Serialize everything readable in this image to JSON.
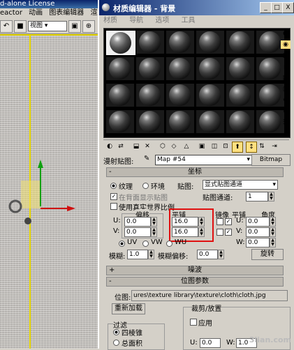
{
  "app": {
    "title": "d-alone License",
    "menu": [
      "eactor",
      "动画",
      "图表编辑器",
      "渲染"
    ],
    "view_select": "视图"
  },
  "material_editor": {
    "title": "材质编辑器 - 背景",
    "menu": [
      "材质",
      "导航",
      "选项",
      "工具"
    ],
    "window_buttons": [
      "_",
      "□",
      "X"
    ],
    "map_label": "漫射贴图:",
    "map_name": "Map #54",
    "map_type_button": "Bitmap",
    "coords_rollout": {
      "header": "坐标",
      "texture_radio": "纹理",
      "environ_radio": "环境",
      "mapping_label": "贴图:",
      "mapping_value": "显式贴图通道",
      "show_map_back": "在背面显示贴图",
      "map_channel_label": "贴图通道:",
      "map_channel_value": "1",
      "real_world_label": "使用真实世界比例",
      "offset_header": "偏移",
      "tiling_header": "平铺",
      "mirror_header": "镜像",
      "tile_header": "平铺",
      "angle_header": "角度",
      "u_label": "U:",
      "v_label": "V:",
      "w_label": "W:",
      "u_offset": "0.0",
      "v_offset": "0.0",
      "u_tiling": "16.0",
      "v_tiling": "16.0",
      "u_angle": "0.0",
      "v_angle": "0.0",
      "w_angle": "0.0",
      "uv_radio": "UV",
      "vw_radio": "VW",
      "wu_radio": "WU",
      "blur_label": "模糊:",
      "blur_value": "1.0",
      "blur_offset_label": "模糊偏移:",
      "blur_offset_value": "0.0",
      "rotate_button": "旋转"
    },
    "noise_rollout": {
      "header": "噪波"
    },
    "bitmap_rollout": {
      "header": "位图参数",
      "bitmap_label": "位图:",
      "bitmap_path": "ures\\texture library\\texture\\cloth\\cloth.jpg",
      "reload_button": "重新加载",
      "crop_group": "裁剪/放置",
      "apply_label": "应用",
      "filter_group": "过滤",
      "filter_pyramidal": "四棱锥",
      "filter_sat": "总面积",
      "u_label": "U:",
      "u_value": "0.0",
      "w_label": "W:",
      "w_value": "1.0"
    },
    "watermark": "3lian.com"
  }
}
